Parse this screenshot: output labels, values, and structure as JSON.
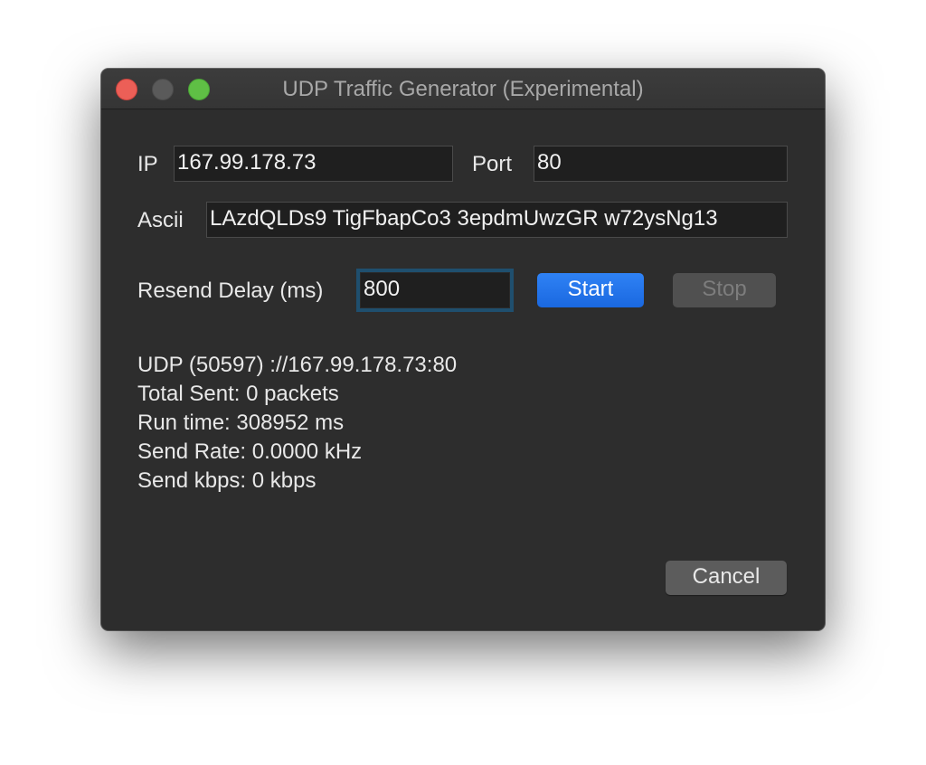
{
  "window": {
    "title": "UDP Traffic Generator (Experimental)"
  },
  "form": {
    "ip_label": "IP",
    "ip_value": "167.99.178.73",
    "port_label": "Port",
    "port_value": "80",
    "ascii_label": "Ascii",
    "ascii_value": "LAzdQLDs9 TigFbapCo3 3epdmUwzGR w72ysNg13",
    "delay_label": "Resend Delay (ms)",
    "delay_value": "800"
  },
  "buttons": {
    "start_label": "Start",
    "stop_label": "Stop",
    "cancel_label": "Cancel"
  },
  "status": {
    "endpoint": "UDP (50597) ://167.99.178.73:80",
    "total_sent": "Total Sent: 0 packets",
    "run_time": "Run time: 308952 ms",
    "send_rate": "Send Rate: 0.0000 kHz",
    "send_kbps": "Send kbps: 0 kbps"
  },
  "colors": {
    "accent": "#1a68e0",
    "close": "#ec5f57",
    "zoom": "#5fbf45"
  }
}
